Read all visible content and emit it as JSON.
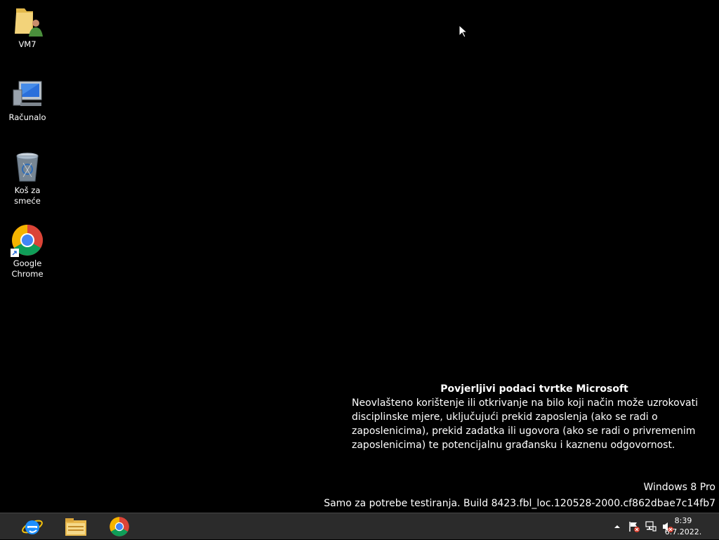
{
  "desktop": {
    "icons": [
      {
        "label": "VM7",
        "icon": "user-folder-icon"
      },
      {
        "label": "Računalo",
        "icon": "computer-icon"
      },
      {
        "label": "Koš za smeće",
        "icon": "recycle-bin-icon"
      },
      {
        "label": "Google Chrome",
        "icon": "chrome-shortcut-icon"
      }
    ]
  },
  "watermark": {
    "title": "Povjerljivi podaci tvrtke Microsoft",
    "body": "Neovlašteno korištenje ili otkrivanje na bilo koji način može uzrokovati disciplinske mjere, uključujući prekid zaposlenja (ako se radi o zaposlenicima), prekid zadatka ili ugovora (ako se radi o privremenim zaposlenicima) te potencijalnu građansku i kaznenu odgovornost.",
    "edition": "Windows 8 Pro",
    "build": "Samo za potrebe testiranja. Build 8423.fbl_loc.120528-2000.cf862dbae7c14fb7"
  },
  "taskbar": {
    "pinned": [
      {
        "icon": "internet-explorer-icon"
      },
      {
        "icon": "file-explorer-icon"
      },
      {
        "icon": "chrome-icon"
      }
    ],
    "tray": {
      "icons": [
        "show-hidden-icons-chevron",
        "action-center-flag-icon",
        "network-icon",
        "volume-muted-icon"
      ],
      "time": "8:39",
      "date": "6.7.2022."
    }
  },
  "colors": {
    "desktop_bg": "#000000",
    "taskbar_bg": "#2b2b2b"
  }
}
